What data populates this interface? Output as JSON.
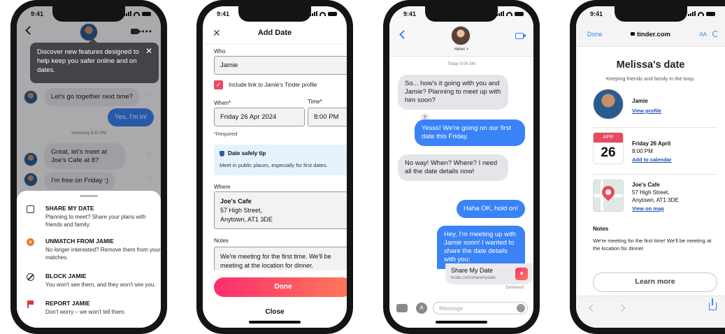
{
  "status": {
    "time": "9:41"
  },
  "phone1": {
    "tooltip": "Discover new features designed to help keep you safer online and on dates.",
    "messages": {
      "m1": "Let's go together next time?",
      "m2": "Yes, I'm in!",
      "day": "Yesterday 9:41 PM",
      "m3": "Great, let's meet at Joe's Cafe at 8?",
      "m4": "I'm free on Friday :)"
    },
    "sheet": [
      {
        "title": "SHARE MY DATE",
        "desc": "Planning to meet? Share your plans with friends and family."
      },
      {
        "title": "UNMATCH FROM JAMIE",
        "desc": "No longer interested? Remove them from your matches."
      },
      {
        "title": "BLOCK JAMIE",
        "desc": "You won't see them, and they won't see you."
      },
      {
        "title": "REPORT JAMIE",
        "desc": "Don't worry – we won't tell them."
      }
    ]
  },
  "phone2": {
    "title": "Add Date",
    "who_label": "Who",
    "who_value": "Jamie",
    "include_label": "Include link to Jamie's Tinder profile",
    "when_label": "When*",
    "when_value": "Friday 26 Apr 2024",
    "time_label": "Time*",
    "time_value": "8:00 PM",
    "required": "*Required",
    "tip_title": "Date safely tip",
    "tip_body": "Meet in public places, especially for first dates.",
    "where_label": "Where",
    "where_name": "Joe's Cafe",
    "where_line1": "57 High Street,",
    "where_line2": "Anytown, AT1 3DE",
    "notes_label": "Notes",
    "notes_value": "We're meeting for the first time. We'll be meeting at the location for dinner.",
    "done": "Done",
    "close": "Close"
  },
  "phone3": {
    "contact": "Helen >",
    "timestamp": "Today 9:08 AM",
    "m1": "So... how's it going with you and Jamie? Planning to meet up with him soon?",
    "tapback": "‼",
    "m2": "Yesss! We're going on our first date this Friday.",
    "m3": "No way! When? Where? I need all the date details now!",
    "m4": "Haha OK, hold on!",
    "m5": "Hey, I'm meeting up with Jamie soon! I wanted to share the date details with you:",
    "link_title": "Share My Date",
    "link_url": "tinder.com/sharemydate",
    "delivered": "Delivered",
    "input_placeholder": "iMessage"
  },
  "phone4": {
    "done": "Done",
    "url": "tinder.com",
    "aa": "AA",
    "title": "Melissa's date",
    "subtitle": "Keeping friends and family in the loop.",
    "name": "Jamie",
    "view_profile": "View profile",
    "cal_month": "APR",
    "cal_day": "26",
    "date_line": "Friday 26 April",
    "time_line": "8:00 PM",
    "add_cal": "Add to calendar",
    "place_name": "Joe's Cafe",
    "place_line1": "57 High Street,",
    "place_line2": "Anytown, AT1 3DE",
    "view_map": "View on map",
    "notes_title": "Notes",
    "notes_body": "We're meeting for the first time! We'll be meeting at the location for dinner.",
    "learn_more": "Learn more"
  }
}
